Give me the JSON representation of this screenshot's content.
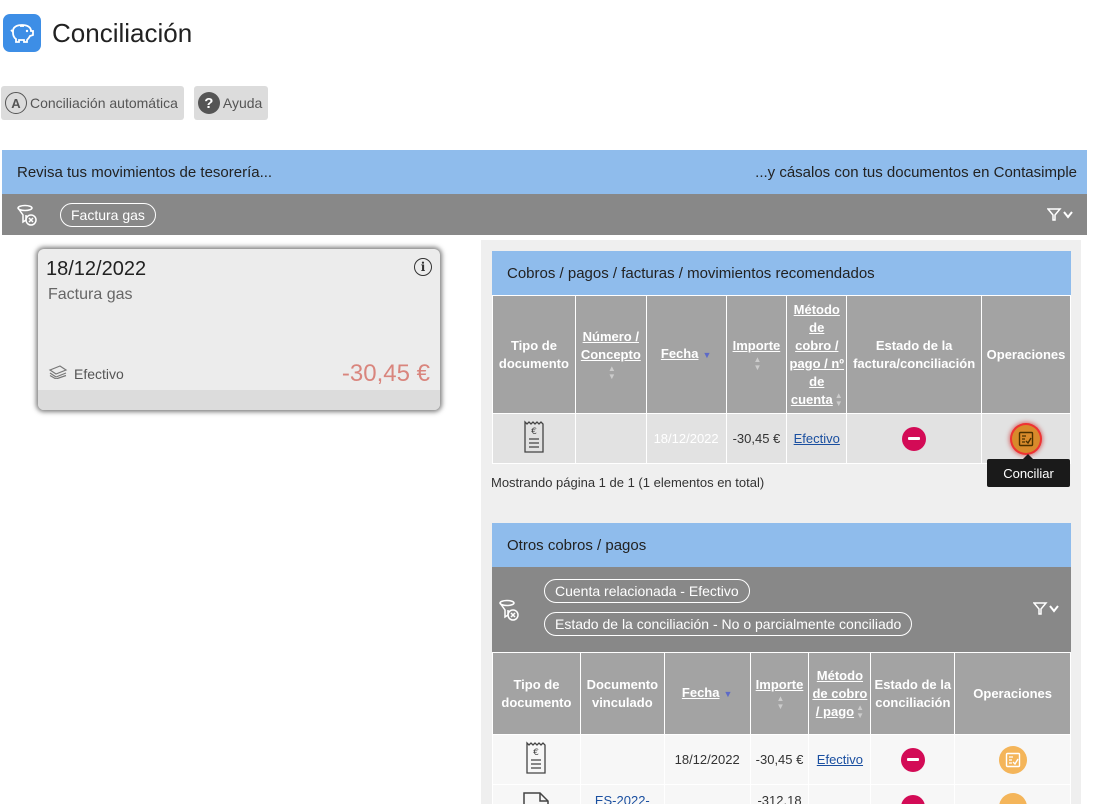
{
  "page": {
    "title": "Conciliación"
  },
  "toolbar": {
    "auto_label": "Conciliación automática",
    "help_label": "Ayuda"
  },
  "banner": {
    "left_text": "Revisa tus movimientos de tesorería...",
    "right_text": "...y cásalos con tus documentos en Contasimple"
  },
  "filter": {
    "chip": "Factura gas"
  },
  "movement": {
    "date": "18/12/2022",
    "concept": "Factura gas",
    "method": "Efectivo",
    "amount": "-30,45 €"
  },
  "recommended": {
    "title": "Cobros / pagos / facturas / movimientos recomendados",
    "columns": {
      "type": "Tipo de documento",
      "number": "Número / Concepto",
      "date": "Fecha",
      "amount": "Importe",
      "method": "Método de cobro / pago / nº de cuenta",
      "status": "Estado de la factura/conciliación",
      "ops": "Operaciones"
    },
    "rows": [
      {
        "number": "",
        "date": "18/12/2022",
        "amount": "-30,45 €",
        "method": "Efectivo"
      }
    ],
    "paging": "Mostrando página 1 de 1 (1 elementos en total)",
    "tooltip": "Conciliar"
  },
  "others": {
    "title": "Otros cobros / pagos",
    "chips": [
      "Cuenta relacionada - Efectivo",
      "Estado de la conciliación - No o parcialmente conciliado"
    ],
    "columns": {
      "type": "Tipo de documento",
      "linked": "Documento vinculado",
      "date": "Fecha",
      "amount": "Importe",
      "method": "Método de cobro / pago",
      "status": "Estado de la conciliación",
      "ops": "Operaciones"
    },
    "rows": [
      {
        "linked": "",
        "date": "18/12/2022",
        "amount": "-30,45 €",
        "method": "Efectivo"
      },
      {
        "linked": "ES-2022-",
        "date": "",
        "amount": "-312,18",
        "method": ""
      }
    ]
  },
  "colors": {
    "accent_blue": "#8fbcec",
    "status_red": "#d30b56",
    "op_orange": "#f4b55a",
    "negative": "#bb0000"
  }
}
